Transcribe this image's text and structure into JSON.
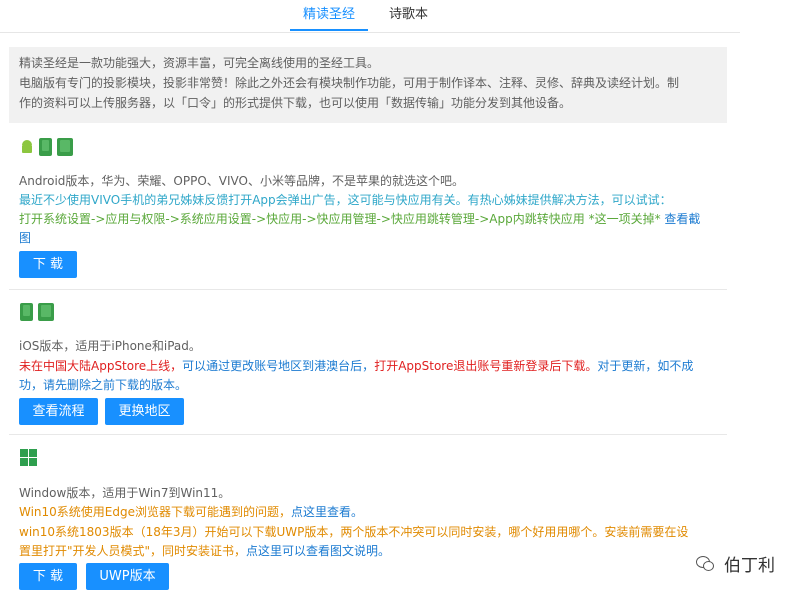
{
  "tabs": [
    {
      "label": "精读圣经",
      "active": true
    },
    {
      "label": "诗歌本",
      "active": false
    }
  ],
  "notice": {
    "line1": "精读圣经是一款功能强大，资源丰富，可完全离线使用的圣经工具。",
    "line2": "电脑版有专门的投影模块，投影非常赞！除此之外还会有模块制作功能，可用于制作译本、注释、灵修、辞典及读经计划。制",
    "line3": "作的资料可以上传服务器，以「口令」的形式提供下载，也可以使用「数据传输」功能分发到其他设备。"
  },
  "android": {
    "icons": [
      "android-icon",
      "phone-icon",
      "tablet-icon"
    ],
    "desc": "Android版本，华为、荣耀、OPPO、VIVO、小米等品牌，不是苹果的就选这个吧。",
    "tip1": "最近不少使用VIVO手机的弟兄姊妹反馈打开App会弹出广告，这可能与快应用有关。有热心姊妹提供解决方法，可以试试：",
    "tip2": "打开系统设置->应用与权限->系统应用设置->快应用->快应用管理->快应用跳转管理->App内跳转快应用 *这一项关掉*",
    "tip2_link_a": "查看截",
    "tip2_link_b": "图",
    "button": "下 载"
  },
  "ios": {
    "icons": [
      "phone-icon",
      "tablet-icon"
    ],
    "desc": "iOS版本，适用于iPhone和iPad。",
    "warn_part1": "未在中国大陆AppStore上线，",
    "warn_part2": "可以通过更改账号地区到港澳台后，",
    "warn_part3": "打开AppStore退出账号重新登录后下载。",
    "warn_part4": "对于更新，如不成",
    "warn_line2": "功，请先删除之前下载的版本。",
    "button1": "查看流程",
    "button2": "更换地区"
  },
  "windows": {
    "icons": [
      "windows-icon"
    ],
    "desc": "Window版本，适用于Win7到Win11。",
    "note1": "Win10系统使用Edge浏览器下载可能遇到的问题，",
    "note1_link": "点这里查看。",
    "note2": "win10系统1803版本（18年3月）开始可以下载UWP版本，两个版本不冲突可以同时安装，哪个好用用哪个。安装前需要在设",
    "note3": "置里打开\"开发人员模式\"，同时安装证书，",
    "note3_link": "点这里可以查看图文说明。",
    "button1": "下 载",
    "button2": "UWP版本"
  },
  "watermark": {
    "icon": "wechat-icon",
    "text": "伯丁利"
  }
}
